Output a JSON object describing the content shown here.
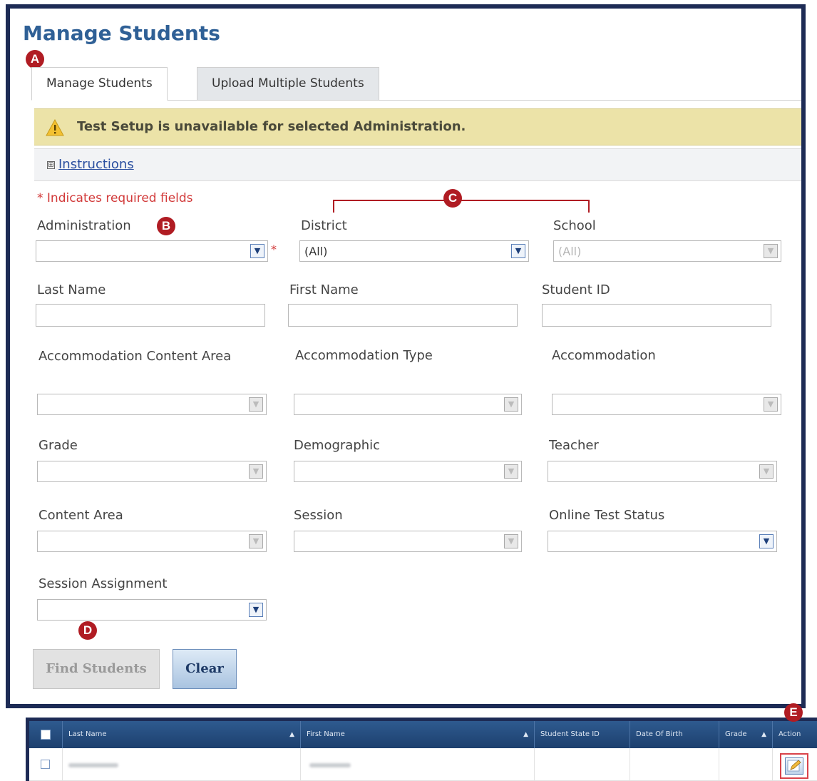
{
  "page": {
    "title": "Manage Students"
  },
  "markers": {
    "a": "A",
    "b": "B",
    "c": "C",
    "d": "D",
    "e": "E"
  },
  "tabs": [
    {
      "label": "Manage Students",
      "active": true
    },
    {
      "label": "Upload Multiple Students",
      "active": false
    }
  ],
  "warning": {
    "text": "Test Setup is unavailable for selected Administration.",
    "icon": "warning-icon"
  },
  "instructions": {
    "link": "Instructions",
    "expand_icon": "⊞"
  },
  "required_note": "* Indicates required fields",
  "form": {
    "administration": {
      "label": "Administration",
      "value": "",
      "required_mark": "*"
    },
    "district": {
      "label": "District",
      "value": "(All)"
    },
    "school": {
      "label": "School",
      "value": "(All)"
    },
    "last_name": {
      "label": "Last Name",
      "value": ""
    },
    "first_name": {
      "label": "First Name",
      "value": ""
    },
    "student_id": {
      "label": "Student ID",
      "value": ""
    },
    "accommodation_content_area": {
      "label": "Accommodation Content Area",
      "value": ""
    },
    "accommodation_type": {
      "label": "Accommodation Type",
      "value": ""
    },
    "accommodation": {
      "label": "Accommodation",
      "value": ""
    },
    "grade": {
      "label": "Grade",
      "value": ""
    },
    "demographic": {
      "label": "Demographic",
      "value": ""
    },
    "teacher": {
      "label": "Teacher",
      "value": ""
    },
    "content_area": {
      "label": "Content Area",
      "value": ""
    },
    "session": {
      "label": "Session",
      "value": ""
    },
    "online_test_status": {
      "label": "Online Test Status",
      "value": ""
    },
    "session_assignment": {
      "label": "Session Assignment",
      "value": ""
    }
  },
  "buttons": {
    "find": "Find Students",
    "clear": "Clear"
  },
  "grid": {
    "headers": [
      "Last Name",
      "First Name",
      "Student State ID",
      "Date Of Birth",
      "Grade",
      "Action"
    ],
    "sort_glyph": "▲"
  },
  "colors": {
    "title": "#2f6096",
    "frame": "#1d2b55",
    "marker": "#b01c23",
    "warning_bg": "#ece3a8",
    "required": "#d23a3a",
    "grid_header": "#1d406e"
  }
}
